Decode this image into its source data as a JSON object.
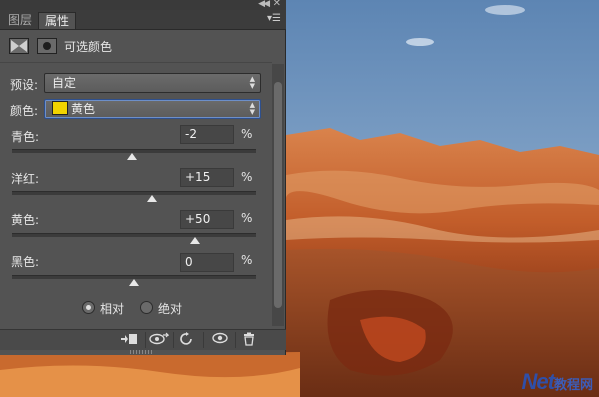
{
  "tabs": [
    {
      "label": "图层",
      "active": false
    },
    {
      "label": "属性",
      "active": true
    }
  ],
  "header": {
    "title": "可选颜色",
    "adjustment_icon": "selective-color-icon",
    "mask_icon": "layer-mask-icon"
  },
  "preset": {
    "label": "预设:",
    "value": "自定"
  },
  "colors": {
    "label": "颜色:",
    "value": "黄色",
    "swatch": "#f2d300"
  },
  "params": [
    {
      "label": "青色:",
      "value": "-2",
      "unit": "%",
      "level_percent": -2
    },
    {
      "label": "洋红:",
      "value": "+15",
      "unit": "%",
      "level_percent": 15
    },
    {
      "label": "黄色:",
      "value": "+50",
      "unit": "%",
      "level_percent": 50
    },
    {
      "label": "黑色:",
      "value": "0",
      "unit": "%",
      "level_percent": 0
    }
  ],
  "method": {
    "options": [
      {
        "label": "相对",
        "checked": true
      },
      {
        "label": "绝对",
        "checked": false
      }
    ]
  },
  "bottom_icons": [
    "clip-to-layer-icon",
    "view-previous-state-icon",
    "reset-icon",
    "visibility-eye-icon",
    "trash-icon"
  ],
  "watermark": {
    "brand": "Net",
    "suffix": "教程网"
  }
}
